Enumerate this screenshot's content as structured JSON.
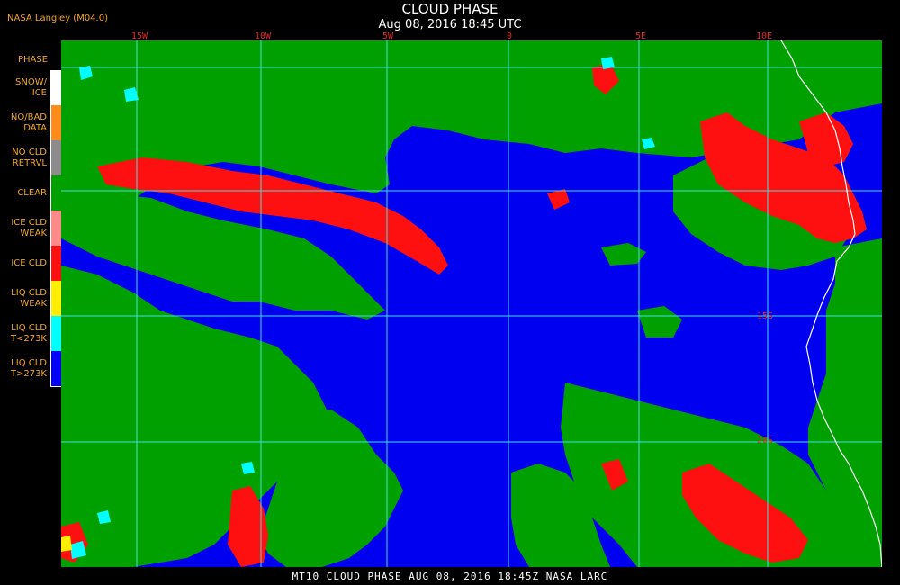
{
  "header": {
    "title": "CLOUD PHASE",
    "datetime": "Aug 08, 2016 18:45 UTC",
    "source": "NASA Langley (M04.0)"
  },
  "legend": {
    "title": "PHASE",
    "items": [
      {
        "label": "SNOW/\nICE",
        "color": "#ffffff"
      },
      {
        "label": "NO/BAD\nDATA",
        "color": "#ff8c1a"
      },
      {
        "label": "NO CLD\nRETRVL",
        "color": "#8c8c8c"
      },
      {
        "label": "CLEAR",
        "color": "#00a000"
      },
      {
        "label": "ICE CLD\nWEAK",
        "color": "#ff8a8a"
      },
      {
        "label": "ICE CLD",
        "color": "#ff1010"
      },
      {
        "label": "LIQ CLD\nWEAK",
        "color": "#ffee00"
      },
      {
        "label": "LIQ CLD\nT<273K",
        "color": "#00ffff"
      },
      {
        "label": "LIQ CLD\nT>273K",
        "color": "#0000ff"
      }
    ]
  },
  "map": {
    "lon_labels": [
      "15W",
      "10W",
      "5W",
      "0",
      "5E",
      "10E"
    ],
    "lat_labels": [
      "15S",
      "20S"
    ],
    "colors": {
      "ocean_liq": "#0000f0",
      "clear": "#00a000",
      "ice": "#ff1010",
      "liq_cold": "#00ffff",
      "grid": "#40e0e0",
      "coast": "#ffffff"
    }
  },
  "footer": {
    "text": "MT10  CLOUD PHASE   AUG 08, 2016 18:45Z   NASA LARC"
  }
}
